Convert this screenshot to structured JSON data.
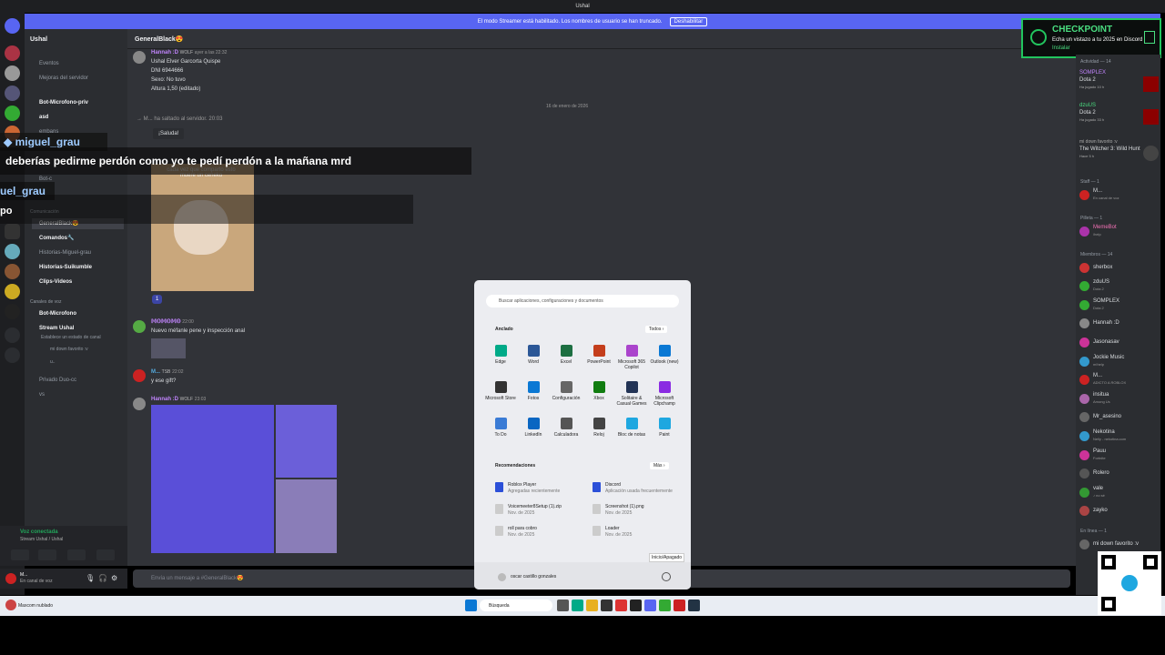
{
  "title": "Ushal",
  "streamer": {
    "text": "El modo Streamer está habilitado. Los nombres de usuario se han truncado.",
    "button": "Deshabilitar"
  },
  "server": {
    "name": "Ushal",
    "channels": [
      {
        "label": "Eventos"
      },
      {
        "label": "Mejoras del servidor"
      },
      {
        "label": "Bot-Microfono-priv"
      },
      {
        "label": "asd"
      },
      {
        "label": "embans"
      },
      {
        "label": "Bot-c"
      },
      {
        "label": "Comunicación"
      },
      {
        "label": "GeneralBlack😍"
      },
      {
        "label": "Comandos🔧"
      },
      {
        "label": "Historias-Miguel-grau"
      },
      {
        "label": "Historias-Suikumble"
      },
      {
        "label": "Clips-Videos"
      },
      {
        "label": "Canales de voz"
      },
      {
        "label": "Bot-Microfono"
      },
      {
        "label": "Stream Ushal"
      },
      {
        "label": "Establece un estado de canal"
      },
      {
        "label": "mi down favorito :v"
      },
      {
        "label": "u.."
      },
      {
        "label": "Privado Duo-cc"
      },
      {
        "label": "vs"
      }
    ]
  },
  "chat": {
    "channel": "GeneralBlack😍",
    "date_divider": "16 de enero de 2026",
    "messages": [
      {
        "name": "Hannah :D",
        "tag": "WOLF",
        "time": "ayer a las 22:32",
        "lines": [
          "Ushal Elver Garcorta Quispe",
          "DNI 6944666",
          "Sexo: No tuvo",
          "Altura 1,50 (editado)"
        ]
      },
      {
        "join": "M... ha saltado al servidor.",
        "time": "20:03",
        "wave": "¡Saluda!"
      },
      {
        "meme": "cada vez que comparto esto muere un ceneko",
        "reactions": [
          "1"
        ]
      },
      {
        "name": "𝕄𝕆𝕄𝕆𝕄𝕆",
        "time": "22:00",
        "lines": [
          "Nuevo méfanle pene y inspección anal"
        ]
      },
      {
        "name": "M...",
        "tag": "TSB",
        "time": "22:02",
        "lines": [
          "y ese gift?"
        ]
      },
      {
        "name": "Hannah :D",
        "tag": "WOLF",
        "time": "23:03"
      }
    ],
    "composer_placeholder": "Envía un mensaje a #GeneralBlack😍"
  },
  "overlay": {
    "user1": "miguel_grau",
    "text": "deberías pedirme perdón como yo te pedí perdón a la mañana mrd",
    "user2": "uel_grau",
    "extra": "po"
  },
  "checkpoint": {
    "title": "CHECKPOINT",
    "sub": "Echa un vistazo a tu 2025 en Discord",
    "link": "Instalar"
  },
  "members": {
    "activity_header": "Actividad — 14",
    "activity": [
      {
        "name": "SOMPLEX",
        "game": "Dota 2",
        "time": "Ha jugado 10 h"
      },
      {
        "name": "dzuUS",
        "game": "Dota 2",
        "time": "Ha jugado 33 h"
      },
      {
        "name": "mi down favorito :v",
        "game": "The Witcher 3: Wild Hunt",
        "time": "Hace 5 h"
      }
    ],
    "groups": [
      {
        "header": "Staff — 1",
        "items": [
          {
            "name": "M...",
            "sub": "En canal de voz"
          }
        ]
      },
      {
        "header": "Pilleta — 1",
        "items": [
          {
            "name": "MemeBot",
            "sub": "/help"
          }
        ]
      },
      {
        "header": "Miembros — 14",
        "items": [
          {
            "name": "sherbox",
            "sub": ""
          },
          {
            "name": "zduUS",
            "sub": "Dota 2"
          },
          {
            "name": "SOMPLEX",
            "sub": "Dota 2"
          },
          {
            "name": "Hannah :D",
            "sub": ""
          },
          {
            "name": "Jasonasav",
            "sub": ""
          },
          {
            "name": "Jockie Music",
            "sub": "m!help"
          },
          {
            "name": "M...",
            "sub": "ADICTO A ROBLOX"
          },
          {
            "name": "insitua",
            "sub": "Among Us"
          },
          {
            "name": "Mr_asesino",
            "sub": ""
          },
          {
            "name": "Nekotina",
            "sub": "Nelly - nekotina.com"
          },
          {
            "name": "Pauu",
            "sub": "Fortnite"
          },
          {
            "name": "Rolero",
            "sub": ""
          },
          {
            "name": "vale",
            "sub": "♪ no sé"
          },
          {
            "name": "zayko",
            "sub": ""
          }
        ]
      },
      {
        "header": "En línea — 1",
        "items": [
          {
            "name": "mi down favorito :v",
            "sub": ""
          }
        ]
      }
    ]
  },
  "voice": {
    "status": "Voz conectada",
    "channel": "Stream Ushal / Ushal"
  },
  "user": {
    "name": "M...",
    "status": "En canal de voz"
  },
  "startmenu": {
    "search_placeholder": "Buscar aplicaciones, configuraciones y documentos",
    "pinned_label": "Anclado",
    "all_label": "Todos  ›",
    "apps": [
      "Edge",
      "Word",
      "Excel",
      "PowerPoint",
      "Microsoft 365 Copilot",
      "Outlook (new)",
      "Microsoft Store",
      "Fotos",
      "Configuración",
      "Xbox",
      "Solitaire & Casual Games",
      "Microsoft Clipchamp",
      "To Do",
      "LinkedIn",
      "Calculadora",
      "Reloj",
      "Bloc de notas",
      "Paint"
    ],
    "rec_label": "Recomendaciones",
    "more_label": "Más  ›",
    "recs": [
      {
        "title": "Roblox Player",
        "sub": "Agregadas recientemente"
      },
      {
        "title": "Discord",
        "sub": "Aplicación usada frecuentemente"
      },
      {
        "title": "Voicemeeter8Setup (1).zip",
        "sub": "Nov. de 2025"
      },
      {
        "title": "Screenshot (1).png",
        "sub": "Nov. de 2025"
      },
      {
        "title": "roll para cobro",
        "sub": "Nov. de 2025"
      },
      {
        "title": "Loader",
        "sub": "Nov. de 2025"
      }
    ],
    "user": "oscar castillo gonzales",
    "power_tip": "Inicio/Apagado"
  },
  "taskbar": {
    "search": "Búsqueda",
    "left_text": "Maxcom  nublado"
  }
}
